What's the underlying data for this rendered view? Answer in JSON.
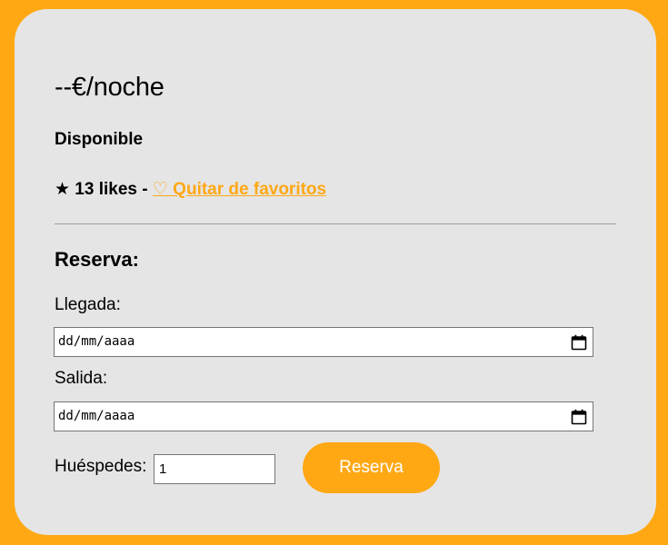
{
  "listing": {
    "price": "--€/noche",
    "availability": "Disponible",
    "likes_text": "★ 13 likes - ",
    "favorite_link": "♡ Quitar de favoritos"
  },
  "booking": {
    "title": "Reserva:",
    "checkin_label": "Llegada:",
    "checkin_placeholder": "dd/mm/aaaa",
    "checkout_label": "Salida:",
    "checkout_placeholder": "dd/mm/aaaa",
    "guests_label": "Huéspedes:",
    "guests_value": "1",
    "submit_label": "Reserva"
  },
  "colors": {
    "accent": "#ffa814",
    "card": "#e5e5e5"
  }
}
